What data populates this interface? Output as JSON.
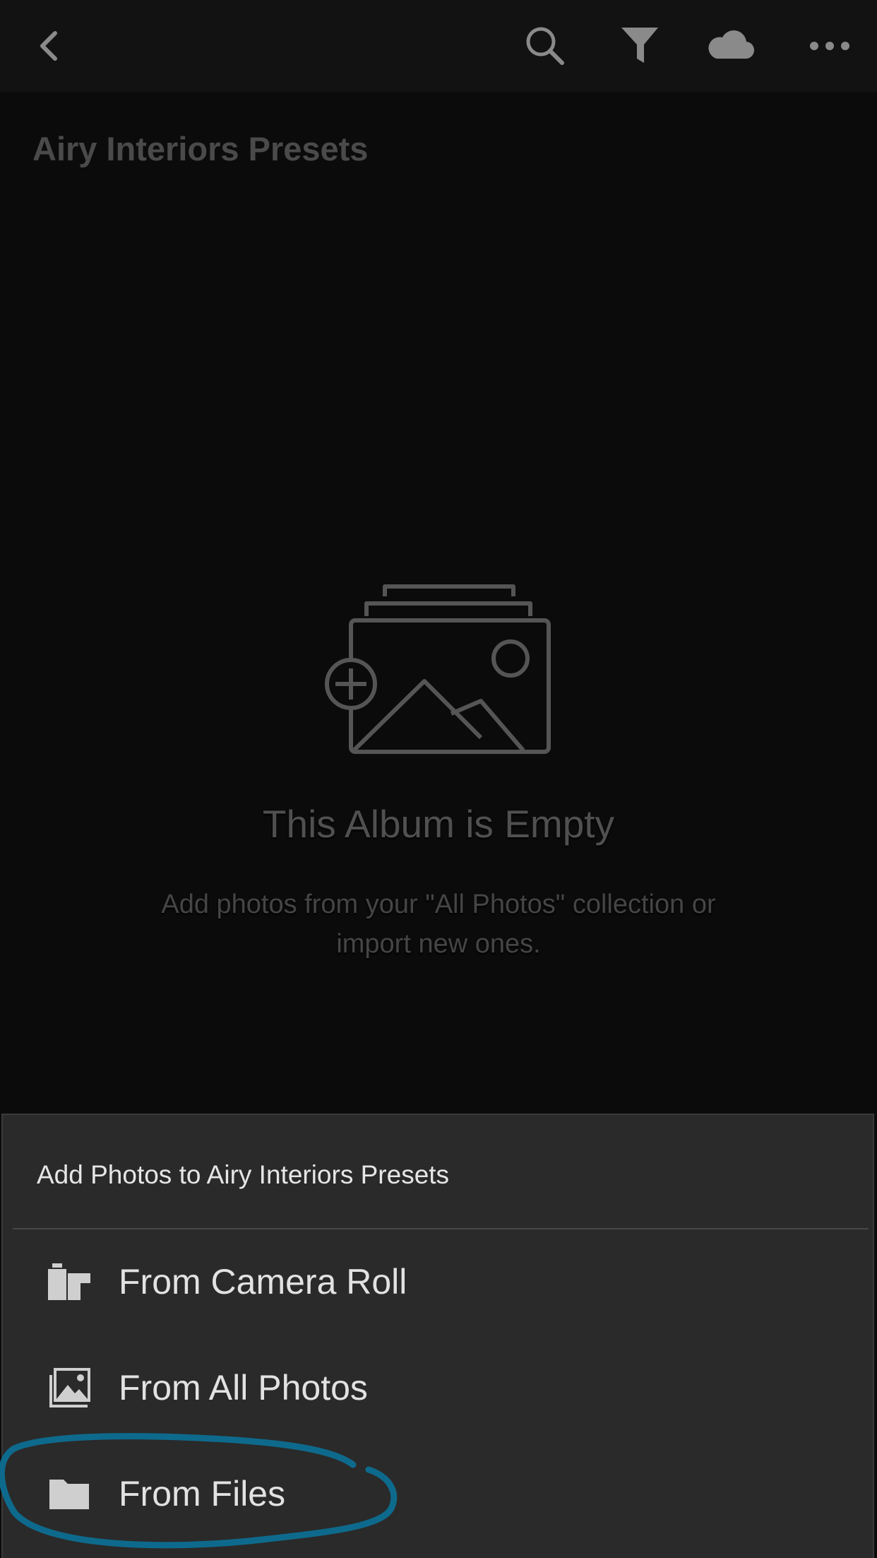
{
  "nav": {
    "back_icon": "chevron-left-icon",
    "search_icon": "search-icon",
    "filter_icon": "filter-icon",
    "cloud_icon": "cloud-icon",
    "more_icon": "more-icon"
  },
  "album": {
    "title": "Airy Interiors Presets"
  },
  "empty_state": {
    "icon": "add-photo-icon",
    "title": "This Album is Empty",
    "description": "Add photos from your \"All Photos\" collection or import new ones."
  },
  "sheet": {
    "title": "Add Photos to Airy Interiors Presets",
    "options": [
      {
        "label": "From Camera Roll",
        "icon": "camera-roll-icon"
      },
      {
        "label": "From All Photos",
        "icon": "photos-icon"
      },
      {
        "label": "From Files",
        "icon": "folder-icon"
      }
    ]
  },
  "colors": {
    "background": "#0b0b0b",
    "topbar": "#121212",
    "sheet": "#2a2a2a",
    "highlight_annotation": "#0e6a8c"
  }
}
